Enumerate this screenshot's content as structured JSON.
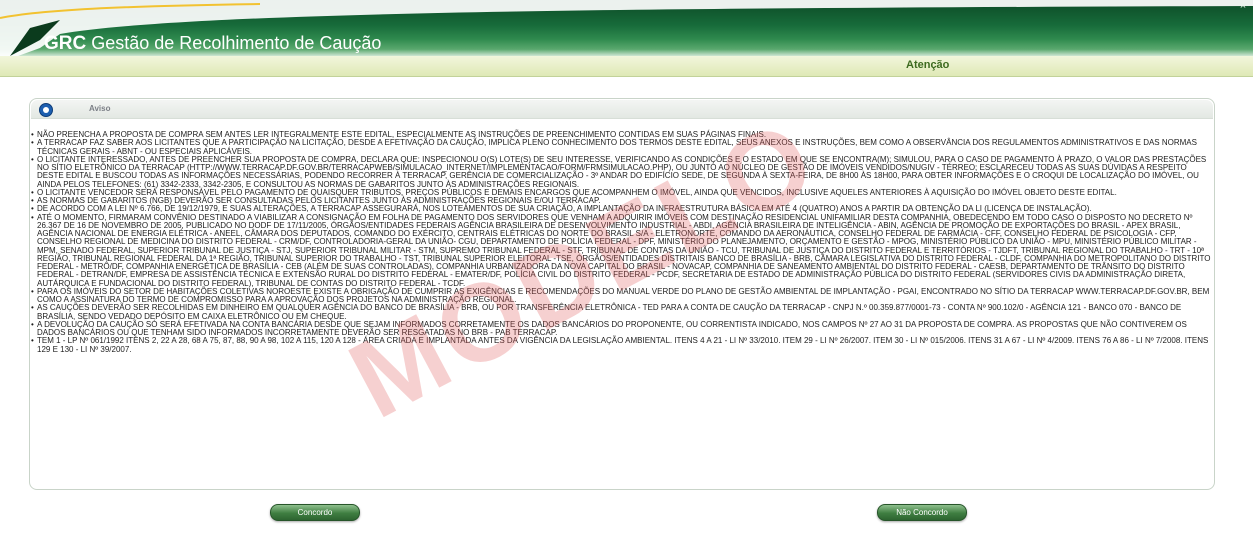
{
  "header": {
    "app_acronym": "GRC",
    "app_name": "Gestão de Recolhimento de Caução",
    "close_glyph": "×"
  },
  "title_bar": {
    "label": "Atenção"
  },
  "panel": {
    "title": "Aviso"
  },
  "notice_items": [
    "NÃO PREENCHA A PROPOSTA DE COMPRA SEM ANTES LER INTEGRALMENTE ESTE EDITAL, ESPECIALMENTE AS INSTRUÇÕES DE PREENCHIMENTO CONTIDAS EM SUAS PÁGINAS FINAIS.",
    "A TERRACAP FAZ SABER AOS LICITANTES QUE A PARTICIPAÇÃO NA LICITAÇÃO, DESDE A EFETIVAÇÃO DA CAUÇÃO, IMPLICA PLENO CONHECIMENTO DOS TERMOS DESTE EDITAL, SEUS ANEXOS E INSTRUÇÕES, BEM COMO A OBSERVÂNCIA DOS REGULAMENTOS ADMINISTRATIVOS E DAS NORMAS TÉCNICAS GERAIS - ABNT - OU ESPECIAIS APLICÁVEIS.",
    "O LICITANTE INTERESSADO, ANTES DE PREENCHER SUA PROPOSTA DE COMPRA, DECLARA QUE: INSPECIONOU O(S) LOTE(S) DE SEU INTERESSE, VERIFICANDO AS CONDIÇÕES E O ESTADO EM QUE SE ENCONTRA(M); SIMULOU, PARA O CASO DE PAGAMENTO À PRAZO, O VALOR DAS PRESTAÇÕES NO SÍTIO ELETRÔNICO DA TERRACAP (HTTP://WWW.TERRACAP.DF.GOV.BR/TERRACAPWEB/SIMULACAO_INTERNET/IMPLEMENTACAO/FORM/FRMSIMULACAO.PHP), OU JUNTO AO NÚCLEO DE GESTÃO DE IMÓVEIS VENDIDOS/NUGIV - TÉRREO; ESCLARECEU TODAS AS SUAS DÚVIDAS A RESPEITO DESTE EDITAL E BUSCOU TODAS AS INFORMAÇÕES NECESSÁRIAS, PODENDO RECORRER À TERRACAP, GERÊNCIA DE COMERCIALIZAÇÃO - 3º ANDAR DO EDIFÍCIO SEDE, DE SEGUNDA À SEXTA-FEIRA, DE 8H00 ÀS 18H00, PARA OBTER INFORMAÇÕES E O CROQUI DE LOCALIZAÇÃO DO IMÓVEL, OU AINDA PELOS TELEFONES: (61) 3342-2333, 3342-2305, E CONSULTOU AS NORMAS DE GABARITOS JUNTO ÀS ADMINISTRAÇÕES REGIONAIS.",
    "O LICITANTE VENCEDOR SERÁ RESPONSÁVEL PELO PAGAMENTO DE QUAISQUER TRIBUTOS, PREÇOS PÚBLICOS E DEMAIS ENCARGOS QUE ACOMPANHEM O IMÓVEL, AINDA QUE VENCIDOS, INCLUSIVE AQUELES ANTERIORES À AQUISIÇÃO DO IMÓVEL OBJETO DESTE EDITAL.",
    "AS NORMAS DE GABARITOS (NGB) DEVERÃO SER CONSULTADAS PELOS LICITANTES JUNTO ÀS ADMINISTRAÇÕES REGIONAIS E/OU TERRACAP.",
    "DE ACORDO COM A LEI Nº 6.766, DE 19/12/1979, E SUAS ALTERAÇÕES, A TERRACAP ASSEGURARÁ, NOS LOTEAMENTOS DE SUA CRIAÇÃO, A IMPLANTAÇÃO DA INFRAESTRUTURA BÁSICA EM ATÉ 4 (QUATRO) ANOS A PARTIR DA OBTENÇÃO DA LI (LICENÇA DE INSTALAÇÃO).",
    "ATÉ O MOMENTO, FIRMARAM CONVÊNIO DESTINADO A VIABILIZAR A CONSIGNAÇÃO EM FOLHA DE PAGAMENTO DOS SERVIDORES QUE VENHAM A ADQUIRIR IMÓVEIS COM DESTINAÇÃO RESIDENCIAL UNIFAMILIAR DESTA COMPANHIA, OBEDECENDO EM TODO CASO O DISPOSTO NO DECRETO Nº 26.367 DE 16 DE NOVEMBRO DE 2005, PUBLICADO NO DODF DE 17/11/2005, ÓRGÃOS/ENTIDADES FEDERAIS AGÊNCIA BRASILEIRA DE DESENVOLVIMENTO INDUSTRIAL - ABDI, AGÊNCIA BRASILEIRA DE INTELIGÊNCIA - ABIN, AGÊNCIA DE PROMOÇÃO DE EXPORTAÇÕES DO BRASIL - APEX BRASIL, AGÊNCIA NACIONAL DE ENERGIA ELÉTRICA - ANEEL, CÂMARA DOS DEPUTADOS, COMANDO DO EXÉRCITO, CENTRAIS ELÉTRICAS DO NORTE DO BRASIL S/A - ELETRONORTE, COMANDO DA AERONÁUTICA, CONSELHO FEDERAL DE FARMÁCIA - CFF, CONSELHO FEDERAL DE PSICOLOGIA - CFP, CONSELHO REGIONAL DE MEDICINA DO DISTRITO FEDERAL - CRM/DF, CONTROLADORIA-GERAL DA UNIÃO- CGU, DEPARTAMENTO DE POLÍCIA FEDERAL - DPF, MINISTÉRIO DO PLANEJAMENTO, ORÇAMENTO E GESTÃO - MPOG, MINISTÉRIO PÚBLICO DA UNIÃO - MPU, MINISTÉRIO PÚBLICO MILITAR - MPM, SENADO FEDERAL, SUPERIOR TRIBUNAL DE JUSTIÇA - STJ, SUPERIOR TRIBUNAL MILITAR - STM, SUPREMO TRIBUNAL FEDERAL - STF, TRIBUNAL DE CONTAS DA UNIÃO - TCU, TRIBUNAL DE JUSTIÇA DO DISTRITO FEDERAL E TERRITÓRIOS - TJDFT, TRIBUNAL REGIONAL DO TRABALHO - TRT - 10ª REGIÃO, TRIBUNAL REGIONAL FEDERAL DA 1ª REGIÃO, TRIBUNAL SUPERIOR DO TRABALHO - TST, TRIBUNAL SUPERIOR ELEITORAL -TSE, ÓRGÃOS/ENTIDADES DISTRITAIS BANCO DE BRASÍLIA - BRB, CÂMARA LEGISLATIVA DO DISTRITO FEDERAL - CLDF, COMPANHIA DO METROPOLITANO DO DISTRITO FEDERAL - METRÔ/DF, COMPANHIA ENERGÉTICA DE BRASÍLIA - CEB (ALÉM DE SUAS CONTROLADAS), COMPANHIA URBANIZADORA DA NOVA CAPITAL DO BRASIL - NOVACAP, COMPANHIA DE SANEAMENTO AMBIENTAL DO DISTRITO FEDERAL - CAESB, DEPARTAMENTO DE TRÂNSITO DO DISTRITO FEDERAL - DETRAN/DF, EMPRESA DE ASSISTÊNCIA TÉCNICA E EXTENSÃO RURAL DO DISTRITO FEDERAL - EMATER/DF, POLÍCIA CIVIL DO DISTRITO FEDERAL - PCDF, SECRETARIA DE ESTADO DE ADMINISTRAÇÃO PÚBLICA DO DISTRITO FEDERAL (SERVIDORES CIVIS DA ADMINISTRAÇÃO DIRETA, AUTÁRQUICA E FUNDACIONAL DO DISTRITO FEDERAL), TRIBUNAL DE CONTAS DO DISTRITO FEDERAL - TCDF.",
    "PARA OS IMÓVEIS DO SETOR DE HABITAÇÕES COLETIVAS NOROESTE EXISTE A OBRIGAÇÃO DE CUMPRIR AS EXIGÊNCIAS E RECOMENDAÇÕES DO MANUAL VERDE DO PLANO DE GESTÃO AMBIENTAL DE IMPLANTAÇÃO - PGAI, ENCONTRADO NO SÍTIO DA TERRACAP WWW.TERRACAP.DF.GOV.BR, BEM COMO A ASSINATURA DO TERMO DE COMPROMISSO PARA A APROVAÇÃO DOS PROJETOS NA ADMINISTRAÇÃO REGIONAL.",
    "AS CAUÇÕES DEVERÃO SER RECOLHIDAS EM DINHEIRO EM QUALQUER AGÊNCIA DO BANCO DE BRASÍLIA - BRB, OU POR TRANSFERÊNCIA ELETRÔNICA - TED PARA A CONTA DE CAUÇÃO DA TERRACAP - CNPJ N.º 00.359.877/0001-73 - CONTA Nº 900.102/0 - AGÊNCIA 121 - BANCO 070 - BANCO DE BRASÍLIA, SENDO VEDADO DEPÓSITO EM CAIXA ELETRÔNICO OU EM CHEQUE.",
    "A DEVOLUÇÃO DA CAUÇÃO SÓ SERÁ EFETIVADA NA CONTA BANCÁRIA DESDE QUE SEJAM INFORMADOS CORRETAMENTE OS DADOS BANCÁRIOS DO PROPONENTE, OU CORRENTISTA INDICADO, NOS CAMPOS Nº 27 AO 31 DA PROPOSTA DE COMPRA. AS PROPOSTAS QUE NÃO CONTIVEREM OS DADOS BANCÁRIOS OU QUE TENHAM SIDO INFORMADOS INCORRETAMENTE DEVERÃO SER RESGATADAS NO BRB - PAB TERRACAP.",
    "TEM 1 - LP Nº 061/1992 ITENS 2, 22 A 28, 68 A 75, 87, 88, 90 A 98, 102 A 115, 120 A 128 - ÁREA CRIADA E IMPLANTADA ANTES DA VIGÊNCIA DA LEGISLAÇÃO AMBIENTAL. ITENS 4 A 21 - LI Nº 33/2010. ITEM 29 - LI Nº 26/2007. ITEM 30 - LI Nº 015/2006. ITENS 31 A 67 - LI Nº 4/2009. ITENS 76 A 86 - LI Nº 7/2008. ITENS 129 E 130 - LI Nº 39/2007."
  ],
  "watermark": "MODELO",
  "actions": {
    "agree_label": "Concordo",
    "disagree_label": "Não Concordo"
  },
  "colors": {
    "header_dark": "#0c4a26",
    "header_light": "#5aa86e",
    "title_bar": "#dfe9b6",
    "title_text": "#3d6a1f",
    "button": "#3f7e41",
    "watermark": "#e25858"
  }
}
